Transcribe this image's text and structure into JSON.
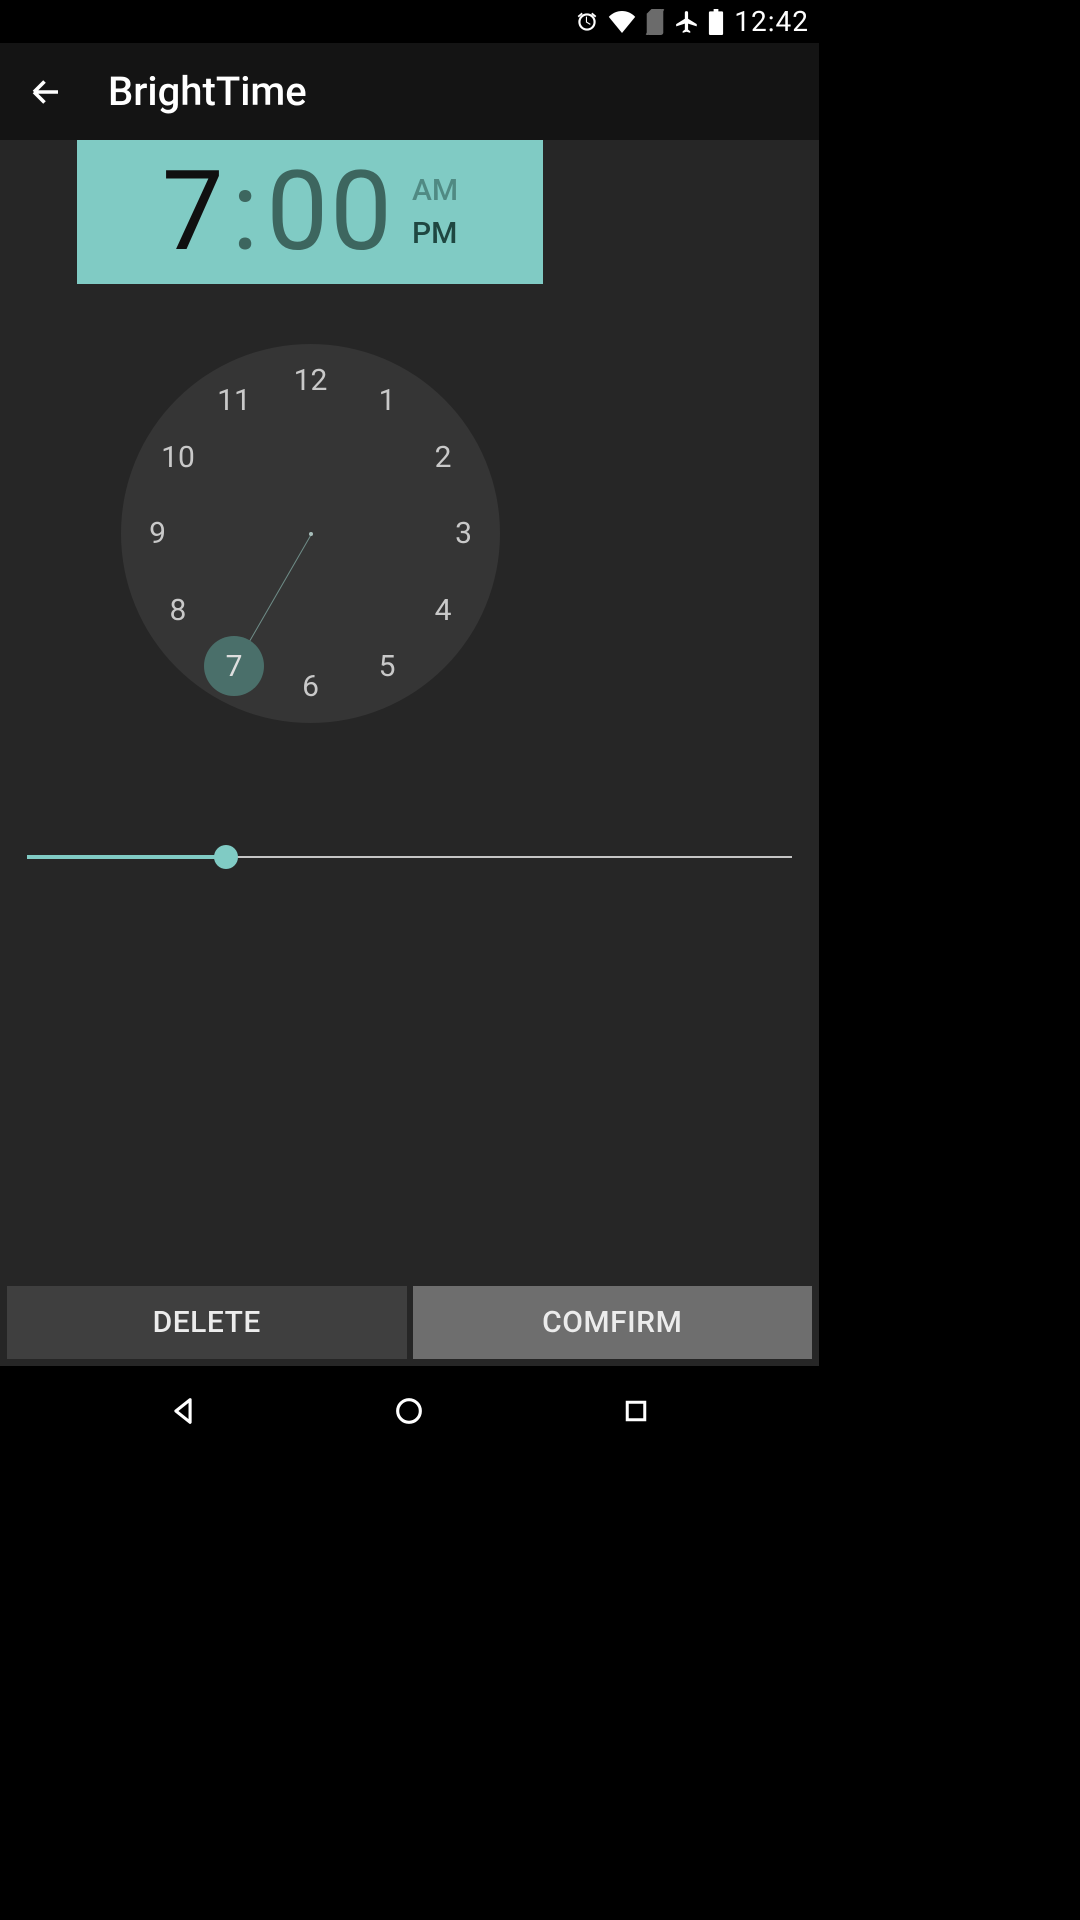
{
  "statusbar": {
    "time": "12:42"
  },
  "appbar": {
    "title": "BrightTime"
  },
  "time": {
    "hour": "7",
    "colon": ":",
    "minute": "00",
    "am": "AM",
    "pm": "PM",
    "selected_period": "PM",
    "selected_hour": 7
  },
  "clock": {
    "numbers": [
      "12",
      "1",
      "2",
      "3",
      "4",
      "5",
      "6",
      "7",
      "8",
      "9",
      "10",
      "11"
    ]
  },
  "slider": {
    "percent": 26
  },
  "buttons": {
    "delete": "DELETE",
    "confirm": "COMFIRM"
  }
}
